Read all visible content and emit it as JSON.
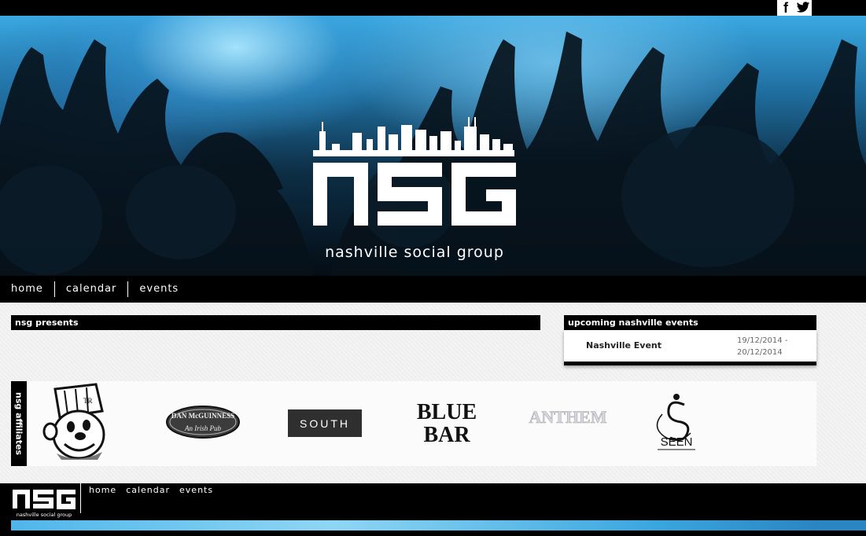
{
  "social": {
    "facebook": "f",
    "twitter": "twitter"
  },
  "brand": {
    "name": "NSG",
    "tagline": "nashville social group"
  },
  "nav": [
    "home",
    "calendar",
    "events"
  ],
  "presents": {
    "heading": "nsg presents"
  },
  "upcoming": {
    "heading": "upcoming nashville events",
    "events": [
      {
        "name": "Nashville Event",
        "date_start": "19/12/2014 -",
        "date_end": "20/12/2014"
      }
    ]
  },
  "affiliates": {
    "heading": "nsg affiliates",
    "logos": {
      "dan": {
        "line1": "DAN McGUINNESS",
        "line2": "An Irish Pub"
      },
      "south": "SOUTH",
      "blue": {
        "line1": "BLUE",
        "line2": "BAR"
      },
      "anthem": "ANTHEM",
      "seen": {
        "name": "SEEN"
      }
    }
  },
  "footer": {
    "nav": [
      "home",
      "calendar",
      "events"
    ],
    "tagline": "nashville social group"
  }
}
